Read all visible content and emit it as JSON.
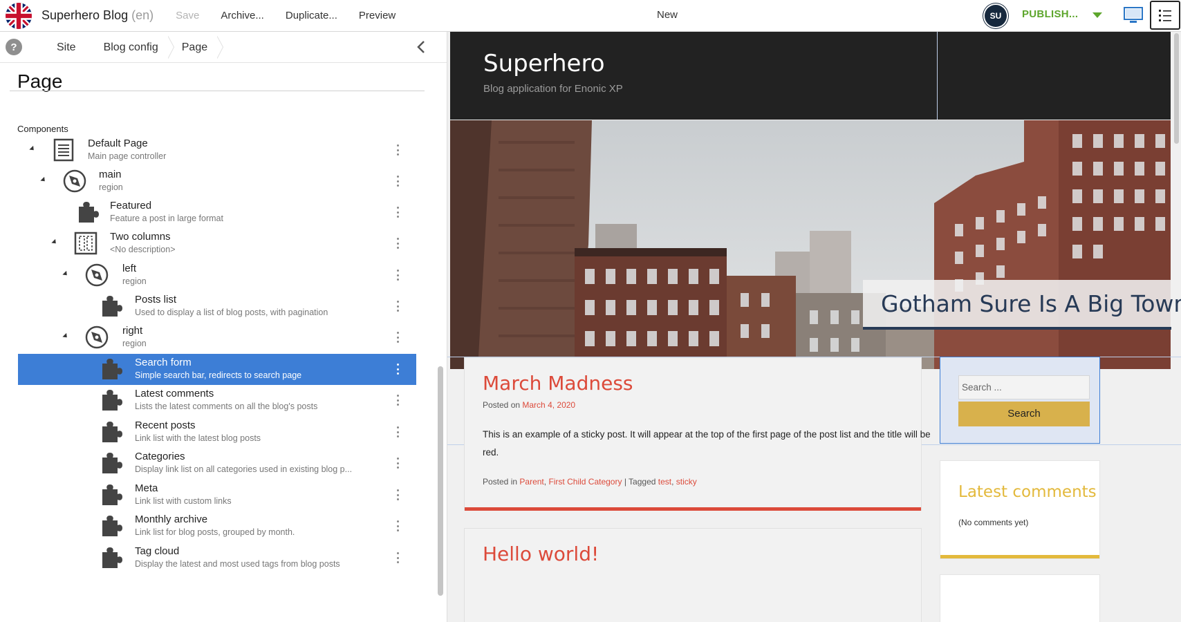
{
  "toolbar": {
    "app_title": "Superhero Blog",
    "lang": "(en)",
    "save_label": "Save",
    "archive_label": "Archive...",
    "duplicate_label": "Duplicate...",
    "preview_label": "Preview",
    "status_label": "New",
    "user_initials": "SU",
    "publish_label": "PUBLISH...",
    "accent_color": "#5da62c"
  },
  "left_panel": {
    "help_label": "?",
    "breadcrumbs": [
      "Site",
      "Blog config",
      "Page"
    ],
    "heading": "Page",
    "components_label": "Components",
    "tree": [
      {
        "title": "Default Page",
        "desc": "Main page controller",
        "icon": "page-icon"
      },
      {
        "title": "main",
        "desc": "region",
        "icon": "region-icon"
      },
      {
        "title": "Featured",
        "desc": "Feature a post in large format",
        "icon": "part-icon"
      },
      {
        "title": "Two columns",
        "desc": "<No description>",
        "icon": "layout-icon"
      },
      {
        "title": "left",
        "desc": "region",
        "icon": "region-icon"
      },
      {
        "title": "Posts list",
        "desc": "Used to display a list of blog posts, with pagination",
        "icon": "part-icon"
      },
      {
        "title": "right",
        "desc": "region",
        "icon": "region-icon"
      },
      {
        "title": "Search form",
        "desc": "Simple search bar, redirects to search page",
        "icon": "part-icon"
      },
      {
        "title": "Latest comments",
        "desc": "Lists the latest comments on all the blog's posts",
        "icon": "part-icon"
      },
      {
        "title": "Recent posts",
        "desc": "Link list with the latest blog posts",
        "icon": "part-icon"
      },
      {
        "title": "Categories",
        "desc": "Display link list on all categories used in existing blog p...",
        "icon": "part-icon"
      },
      {
        "title": "Meta",
        "desc": "Link list with custom links",
        "icon": "part-icon"
      },
      {
        "title": "Monthly archive",
        "desc": "Link list for blog posts, grouped by month.",
        "icon": "part-icon"
      },
      {
        "title": "Tag cloud",
        "desc": "Display the latest and most used tags from blog posts",
        "icon": "part-icon"
      }
    ],
    "selected_color": "#3d7ed6"
  },
  "preview": {
    "site_title": "Superhero",
    "site_tagline": "Blog application for Enonic XP",
    "hero_caption": "Gotham Sure Is A Big Town",
    "posts": [
      {
        "title": "March Madness",
        "posted_on_label": "Posted on",
        "date": "March 4, 2020",
        "body": "This is an example of a sticky post. It will appear at the top of the first page of the post list and the title will be red.",
        "posted_in_label": "Posted in",
        "categories": [
          "Parent",
          "First Child Category"
        ],
        "tagged_label": "| Tagged",
        "tags": [
          "test",
          "sticky"
        ]
      },
      {
        "title": "Hello world!"
      }
    ],
    "search_placeholder": "Search ...",
    "search_button": "Search",
    "latest_comments_title": "Latest comments",
    "latest_comments_text": "(No comments yet)",
    "link_color": "#dc4a3a",
    "widget_accent": "#e3b93c"
  }
}
